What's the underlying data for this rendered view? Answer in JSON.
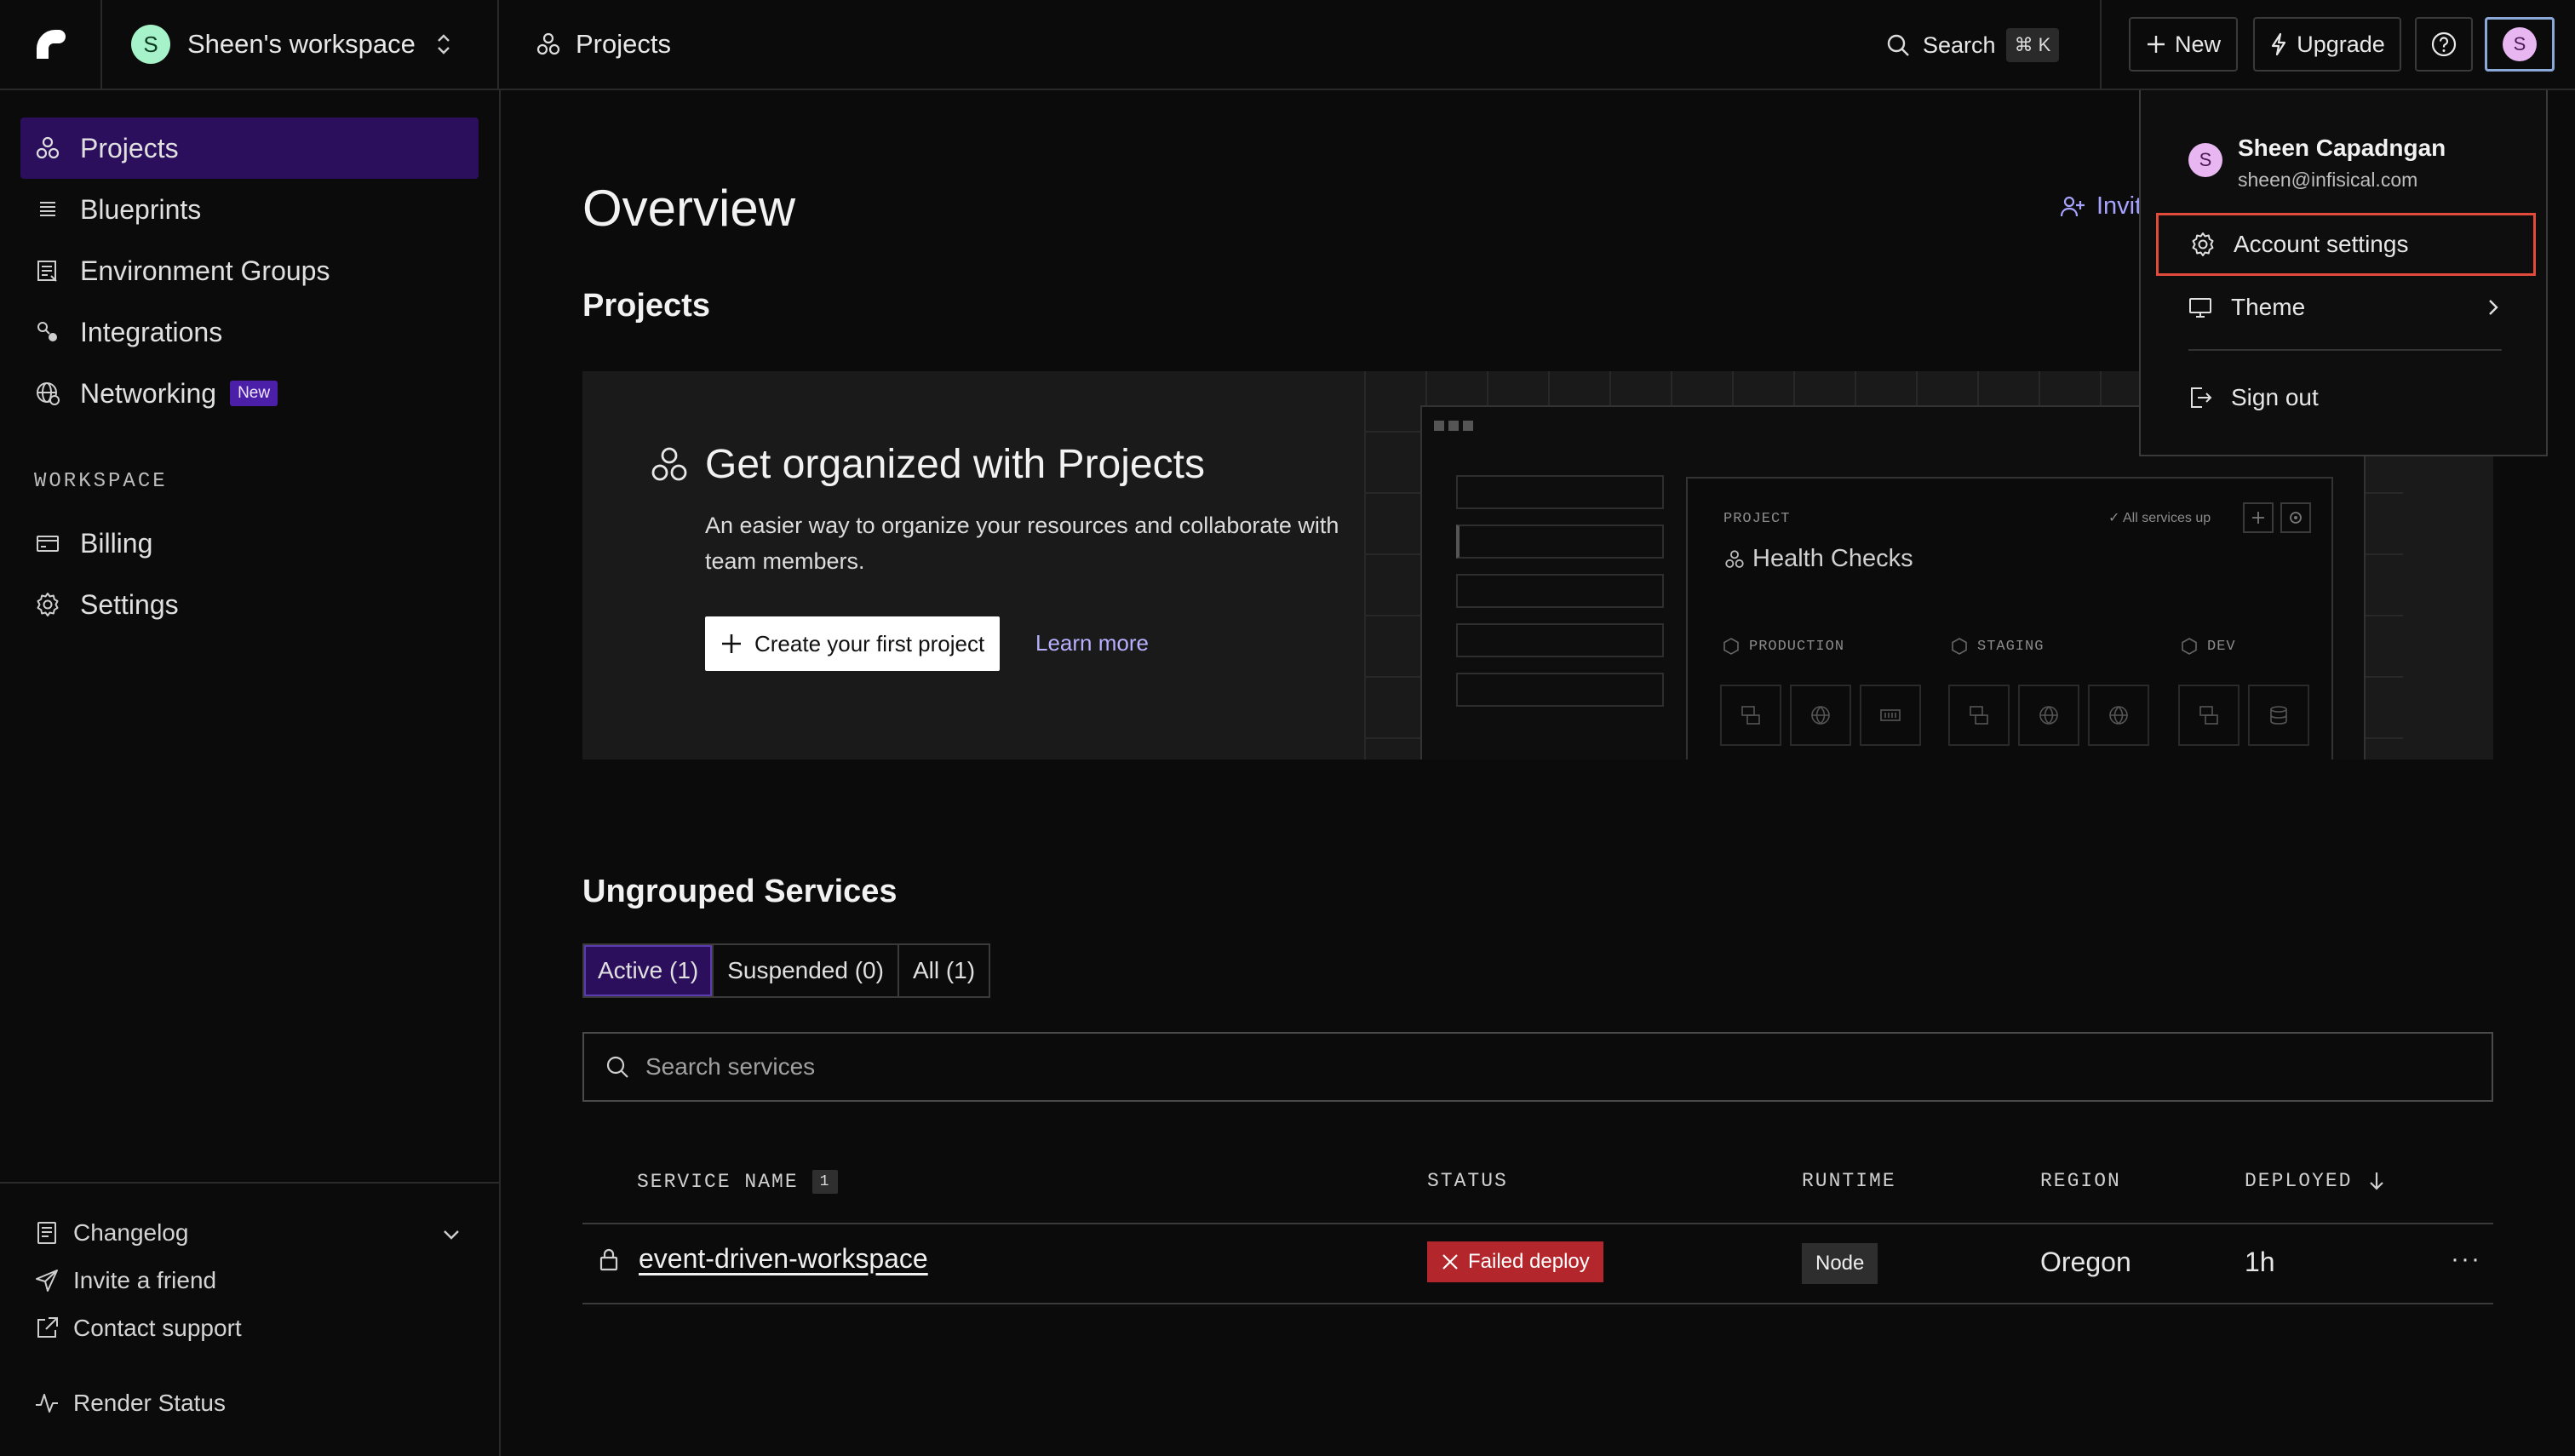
{
  "topbar": {
    "workspace_initial": "S",
    "workspace_name": "Sheen's workspace",
    "breadcrumb": "Projects",
    "search_label": "Search",
    "search_shortcut": "⌘ K",
    "new_label": "New",
    "upgrade_label": "Upgrade",
    "user_initial": "S"
  },
  "sidebar": {
    "items": [
      {
        "label": "Projects",
        "icon": "projects-icon",
        "active": true
      },
      {
        "label": "Blueprints",
        "icon": "blueprints-icon"
      },
      {
        "label": "Environment Groups",
        "icon": "environment-groups-icon"
      },
      {
        "label": "Integrations",
        "icon": "integrations-icon"
      },
      {
        "label": "Networking",
        "icon": "globe-icon",
        "badge": "New"
      }
    ],
    "section_label": "WORKSPACE",
    "workspace_items": [
      {
        "label": "Billing",
        "icon": "billing-icon"
      },
      {
        "label": "Settings",
        "icon": "gear-icon"
      }
    ],
    "footer": {
      "changelog": "Changelog",
      "invite": "Invite a friend",
      "support": "Contact support",
      "status": "Render Status"
    }
  },
  "main": {
    "title": "Overview",
    "invite_partial": "Invit",
    "projects_heading": "Projects",
    "promo": {
      "title": "Get organized with Projects",
      "description": "An easier way to organize your resources and collaborate with team members.",
      "create_label": "Create your first project",
      "learn_more": "Learn more",
      "mock": {
        "project_label": "PROJECT",
        "project_name": "Health Checks",
        "status": "All services up",
        "envs": [
          "PRODUCTION",
          "STAGING",
          "DEV"
        ]
      }
    },
    "ungrouped_heading": "Ungrouped Services",
    "tabs": [
      "Active (1)",
      "Suspended (0)",
      "All (1)"
    ],
    "search_placeholder": "Search services",
    "table": {
      "headers": {
        "service_name": "SERVICE NAME",
        "count": "1",
        "status": "STATUS",
        "runtime": "RUNTIME",
        "region": "REGION",
        "deployed": "DEPLOYED"
      },
      "rows": [
        {
          "name": "event-driven-workspace",
          "status": "Failed deploy",
          "runtime": "Node",
          "region": "Oregon",
          "deployed": "1h",
          "actions": "···"
        }
      ]
    }
  },
  "user_menu": {
    "name": "Sheen Capadngan",
    "email": "sheen@infisical.com",
    "items": {
      "account": "Account settings",
      "theme": "Theme",
      "signout": "Sign out"
    }
  },
  "colors": {
    "accent": "#2b0f5c",
    "link": "#b7b0ff",
    "danger": "#b3262b",
    "highlight": "#e24b3b"
  }
}
